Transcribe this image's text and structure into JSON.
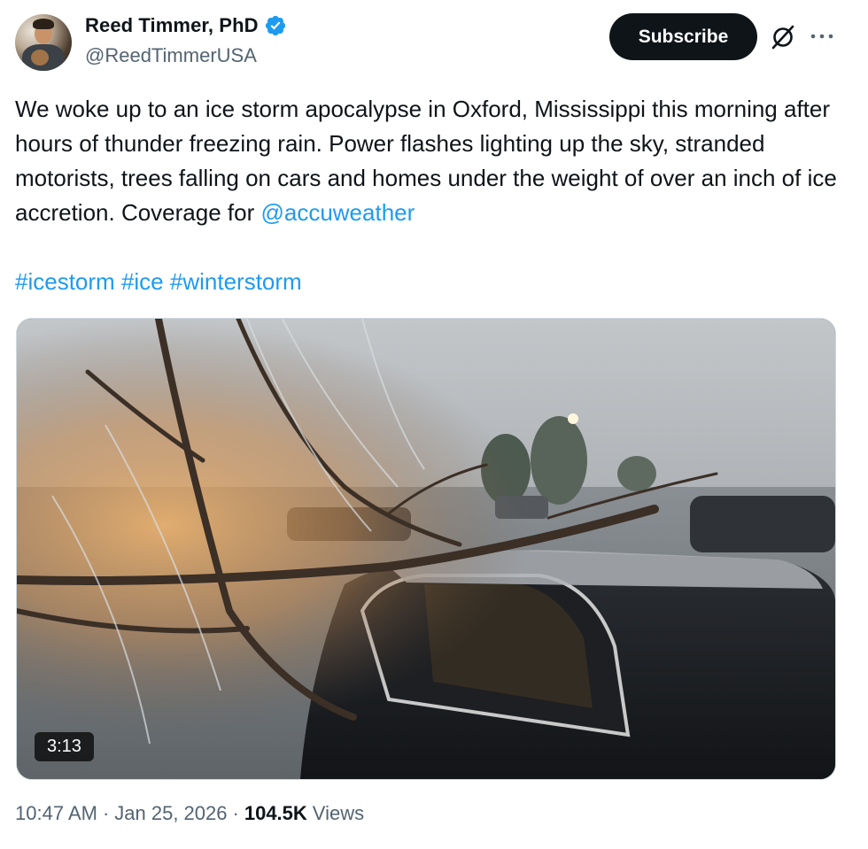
{
  "author": {
    "display_name": "Reed Timmer, PhD",
    "handle": "@ReedTimmerUSA",
    "verified": true,
    "verified_color": "#1d9bf0"
  },
  "actions": {
    "subscribe_label": "Subscribe",
    "grok_icon": "grok-slash-icon",
    "more_icon": "more-horizontal-icon"
  },
  "tweet": {
    "text_main": "We woke up to an ice storm apocalypse in Oxford, Mississippi this morning after hours of thunder freezing rain. Power flashes lighting up the sky, stranded motorists, trees falling on cars and homes under the weight of over an inch of ice accretion. Coverage for ",
    "mention": "@accuweather",
    "hashtags": [
      "#icestorm",
      "#ice",
      "#winterstorm"
    ]
  },
  "media": {
    "type": "video",
    "duration": "3:13"
  },
  "meta": {
    "time": "10:47 AM",
    "separator": "·",
    "date": "Jan 25, 2026",
    "views_count": "104.5K",
    "views_label": "Views"
  },
  "colors": {
    "link": "#1d9bf0",
    "text": "#0f1419",
    "muted": "#536471"
  }
}
